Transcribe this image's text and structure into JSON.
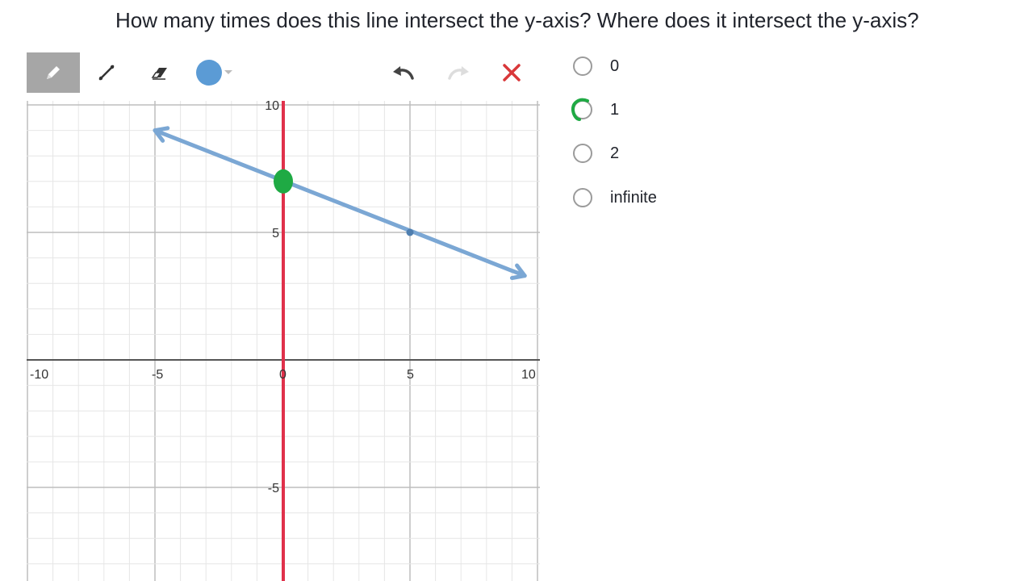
{
  "question": {
    "text": "How many times does this line intersect the y-axis? Where does it intersect the y-axis?"
  },
  "toolbar": {
    "tools": [
      {
        "name": "pencil-tool",
        "icon": "pencil-icon",
        "active": true
      },
      {
        "name": "line-tool",
        "icon": "line-icon",
        "active": false
      },
      {
        "name": "eraser-tool",
        "icon": "eraser-icon",
        "active": false
      },
      {
        "name": "color-picker",
        "icon": "color-dot-icon",
        "color": "#5b9bd5"
      }
    ],
    "undo_icon": "undo-icon",
    "redo_icon": "redo-icon",
    "clear_icon": "close-icon"
  },
  "graph": {
    "x_range": [
      -10,
      10
    ],
    "y_range": [
      -10,
      10
    ],
    "x_tick_labels": [
      "-10",
      "-5",
      "0",
      "5",
      "10"
    ],
    "y_tick_labels": [
      "10",
      "5",
      "-5"
    ],
    "line": {
      "from": [
        -5,
        9
      ],
      "to": [
        9.5,
        3.3
      ],
      "marked_point": [
        5,
        5
      ],
      "color": "#7ba7d4"
    },
    "y_axis_highlight_color": "#e0314b",
    "intersection_point": [
      0,
      7
    ],
    "intersection_color": "#1faa44"
  },
  "options": [
    {
      "label": "0",
      "selected": false
    },
    {
      "label": "1",
      "selected": true
    },
    {
      "label": "2",
      "selected": false
    },
    {
      "label": "infinite",
      "selected": false
    }
  ],
  "annotation_color": "#1faa44"
}
